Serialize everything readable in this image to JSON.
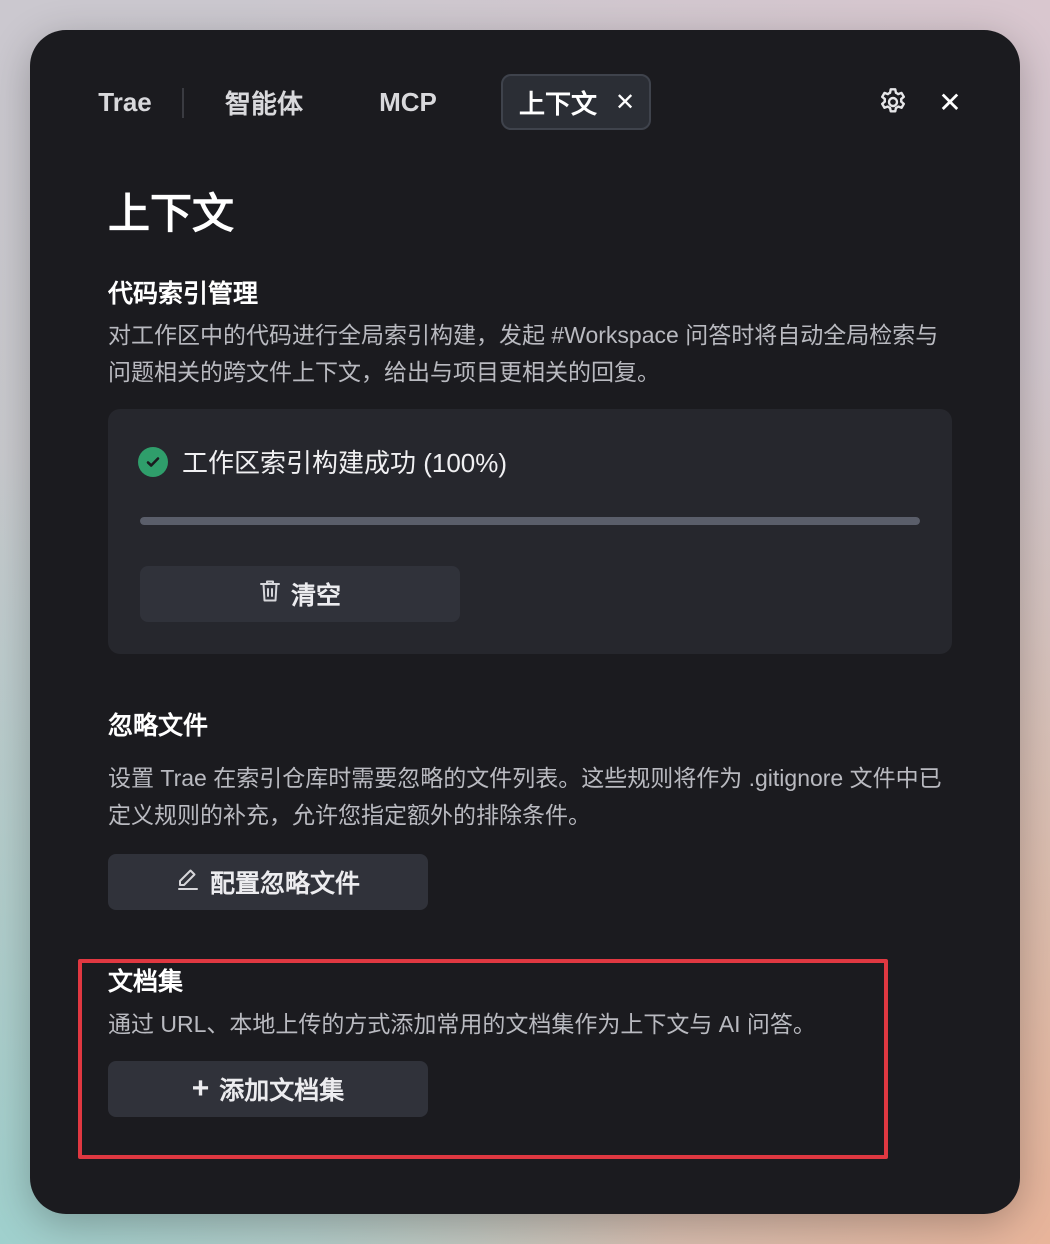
{
  "tabs": {
    "trae": "Trae",
    "agent": "智能体",
    "mcp": "MCP",
    "context": "上下文",
    "close_glyph": "✕"
  },
  "header": {
    "settings_icon": "gear-icon",
    "close_glyph": "✕"
  },
  "page_title": "上下文",
  "code_index": {
    "title": "代码索引管理",
    "description": "对工作区中的代码进行全局索引构建，发起 #Workspace 问答时将自动全局检索与问题相关的跨文件上下文，给出与项目更相关的回复。",
    "status_text": "工作区索引构建成功 (100%)",
    "progress_percent": 100,
    "status_color": "#2f9e6b",
    "clear_button": "清空"
  },
  "ignore_files": {
    "title": "忽略文件",
    "description": "设置 Trae 在索引仓库时需要忽略的文件列表。这些规则将作为 .gitignore 文件中已定义规则的补充，允许您指定额外的排除条件。",
    "config_button": "配置忽略文件"
  },
  "docs": {
    "title": "文档集",
    "description": "通过 URL、本地上传的方式添加常用的文档集作为上下文与 AI 问答。",
    "add_button": "添加文档集",
    "add_glyph": "+"
  },
  "colors": {
    "panel_bg": "#1b1b1f",
    "highlight": "#e03841"
  }
}
